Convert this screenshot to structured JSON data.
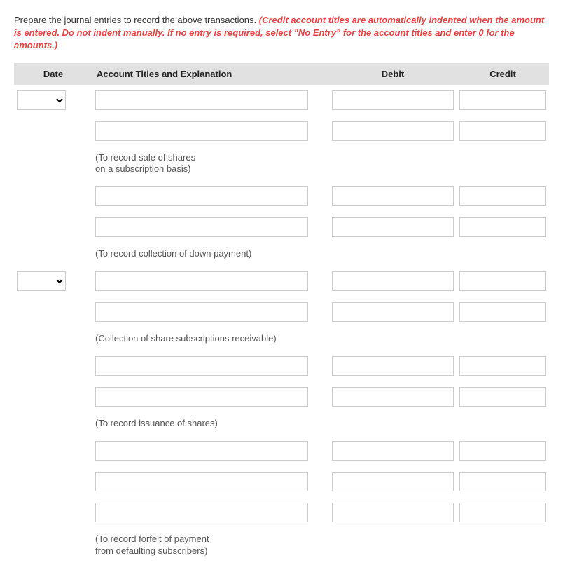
{
  "instruction": {
    "black": "Prepare the journal entries to record the above transactions. ",
    "red": "(Credit account titles are automatically indented when the amount is entered. Do not indent manually. If no entry is required, select \"No Entry\" for the account titles and enter 0 for the amounts.)"
  },
  "headers": {
    "date": "Date",
    "account": "Account Titles and Explanation",
    "debit": "Debit",
    "credit": "Credit"
  },
  "explanations": {
    "e1_line1": "(To record sale of shares",
    "e1_line2": "on a subscription basis)",
    "e2": "(To record collection of down payment)",
    "e3": "(Collection of share subscriptions receivable)",
    "e4": "(To record issuance of shares)",
    "e5_line1": "(To record forfeit of payment",
    "e5_line2": "from defaulting subscribers)"
  }
}
